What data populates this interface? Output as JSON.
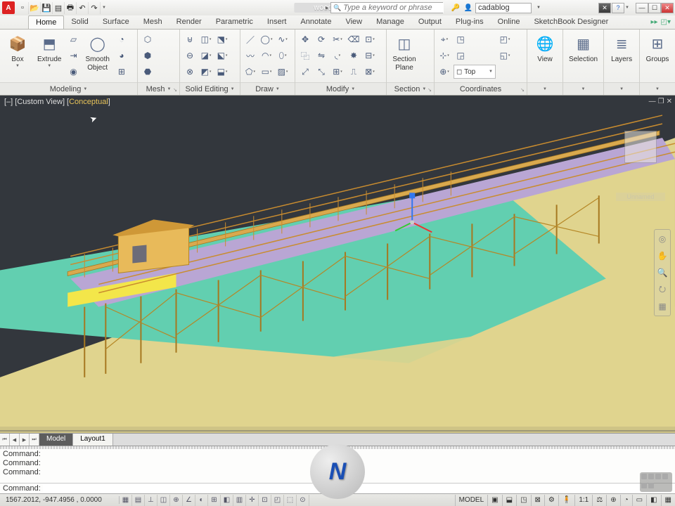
{
  "app": {
    "doc_title": "woodpier.dwg",
    "search_placeholder": "Type a keyword or phrase",
    "user": "cadablog"
  },
  "qat": [
    {
      "name": "new-icon",
      "glyph": "▫"
    },
    {
      "name": "open-icon",
      "glyph": "📂"
    },
    {
      "name": "save-icon",
      "glyph": "💾"
    },
    {
      "name": "saveas-icon",
      "glyph": "▤"
    },
    {
      "name": "print-icon",
      "glyph": "🖶"
    },
    {
      "name": "undo-icon",
      "glyph": "↶"
    },
    {
      "name": "redo-icon",
      "glyph": "↷"
    }
  ],
  "tabs": [
    "Home",
    "Solid",
    "Surface",
    "Mesh",
    "Render",
    "Parametric",
    "Insert",
    "Annotate",
    "View",
    "Manage",
    "Output",
    "Plug-ins",
    "Online",
    "SketchBook Designer"
  ],
  "active_tab": "Home",
  "ribbon": {
    "modeling": {
      "title": "Modeling",
      "box": "Box",
      "extrude": "Extrude",
      "smooth": "Smooth\nObject"
    },
    "mesh": {
      "title": "Mesh"
    },
    "solid_editing": {
      "title": "Solid Editing"
    },
    "draw": {
      "title": "Draw"
    },
    "modify": {
      "title": "Modify"
    },
    "section": {
      "title": "Section",
      "plane": "Section\nPlane"
    },
    "coordinates": {
      "title": "Coordinates",
      "top": "Top"
    },
    "right": {
      "view": "View",
      "selection": "Selection",
      "layers": "Layers",
      "groups": "Groups"
    }
  },
  "viewport": {
    "label_left": "[–] [Custom View] [",
    "visual_style": "Conceptual",
    "label_right": "]",
    "viewcube_face": "",
    "viewcube_label": "Unnamed"
  },
  "model_tabs": {
    "buttons": [
      "⏮",
      "◀",
      "▶",
      "⏭"
    ],
    "tabs": [
      "Model",
      "Layout1"
    ],
    "active": "Model"
  },
  "command": {
    "history": [
      "Command:",
      "Command:",
      "Command:"
    ],
    "prompt": "Command:"
  },
  "status": {
    "coords": "1567.2012, -947.4956 , 0.0000",
    "left_icons": [
      "▦",
      "▤",
      "⊥",
      "◫",
      "⊕",
      "∠",
      "◐",
      "⊞",
      "◧",
      "▥",
      "✛",
      "⊡",
      "◰",
      "⬚",
      "⊙"
    ],
    "model": "MODEL",
    "right_icons": [
      "▣",
      "⬓",
      "◳",
      "⊠",
      "⚙",
      "🧍",
      "1:1",
      "⚖",
      "⊕",
      "◔",
      "▭",
      "◧",
      "▦"
    ]
  },
  "watermark": "N"
}
